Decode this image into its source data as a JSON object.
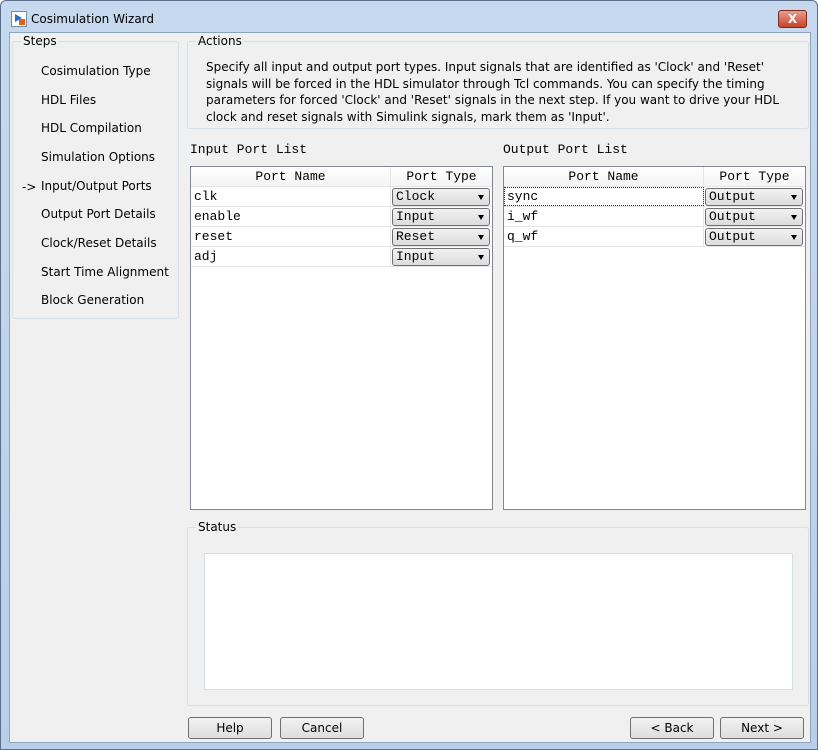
{
  "window": {
    "title": "Cosimulation Wizard",
    "close_label": "X"
  },
  "steps": {
    "label": "Steps",
    "current_marker": "->",
    "items": [
      {
        "label": "Cosimulation Type"
      },
      {
        "label": "HDL Files"
      },
      {
        "label": "HDL Compilation"
      },
      {
        "label": "Simulation Options"
      },
      {
        "label": "Input/Output Ports"
      },
      {
        "label": "Output Port Details"
      },
      {
        "label": "Clock/Reset Details"
      },
      {
        "label": "Start Time Alignment"
      },
      {
        "label": "Block Generation"
      }
    ],
    "current_index": 4
  },
  "actions": {
    "label": "Actions",
    "text": "Specify all input and output port types. Input signals that are identified as 'Clock' and 'Reset' signals will be forced in the HDL simulator through Tcl commands. You can specify the timing parameters for forced 'Clock' and 'Reset' signals in the next step. If you want to drive your HDL clock and reset signals with Simulink signals, mark them as 'Input'."
  },
  "input_ports": {
    "label": "Input Port List",
    "headers": [
      "Port Name",
      "Port Type"
    ],
    "rows": [
      {
        "name": "clk",
        "type": "Clock"
      },
      {
        "name": "enable",
        "type": "Input"
      },
      {
        "name": "reset",
        "type": "Reset"
      },
      {
        "name": "adj",
        "type": "Input"
      }
    ]
  },
  "output_ports": {
    "label": "Output Port List",
    "headers": [
      "Port Name",
      "Port Type"
    ],
    "rows": [
      {
        "name": "sync",
        "type": "Output"
      },
      {
        "name": "i_wf",
        "type": "Output"
      },
      {
        "name": "q_wf",
        "type": "Output"
      }
    ]
  },
  "status": {
    "label": "Status",
    "text": ""
  },
  "buttons": {
    "help": "Help",
    "cancel": "Cancel",
    "back": "< Back",
    "next": "Next >"
  }
}
